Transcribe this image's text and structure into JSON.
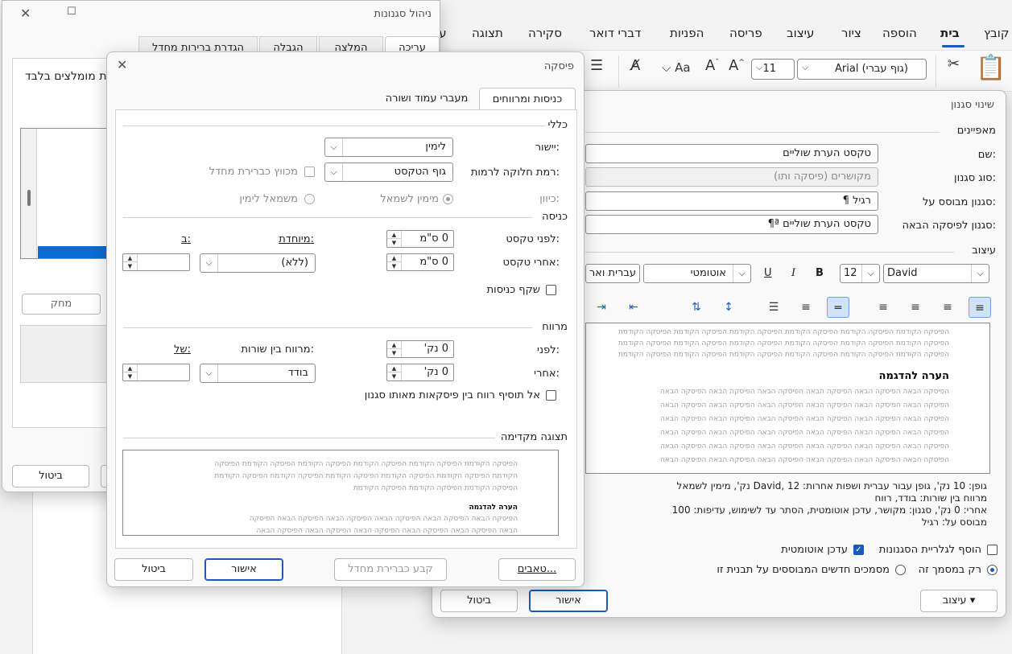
{
  "ribbon": {
    "tabs": [
      "קובץ",
      "בית",
      "הוספה",
      "ציור",
      "עיצוב",
      "פריסה",
      "הפניות",
      "דברי דואר",
      "סקירה",
      "תצוגה",
      "עז"
    ],
    "active_tab": "בית",
    "font_name": "Arial (גוף עברי)",
    "font_size": "11"
  },
  "manage_styles": {
    "title": "ניהול סגנונות",
    "tabs": [
      "עריכה",
      "המלצה",
      "הגבלה",
      "הגדרת ברירות מחדל"
    ],
    "recommended_only": "ת מומלצים בלבד",
    "delete_button": "מחק",
    "cancel_button": "ביטול"
  },
  "modify_style": {
    "title": "שינוי סגנון",
    "properties_header": "מאפיינים",
    "name_label": "שם:",
    "name_value": "טקסט הערת שוליים",
    "style_type_label": "סוג סגנון:",
    "style_type_value": "מקושרים (פיסקה ותו)",
    "based_on_label": "סגנון מבוסס על:",
    "based_on_value": "רגיל",
    "next_style_label": "סגנון לפיסקה הבאה:",
    "next_style_value": "טקסט הערת שוליים",
    "formatting_header": "עיצוב",
    "font_value": "David",
    "size_value": "12",
    "color_value": "אוטומטי",
    "script_value": "עברית ואר",
    "bold": "B",
    "italic": "I",
    "underline": "U",
    "preview_prev": "הפיסקה הקודמת הפיסקה הקודמת הפיסקה הקודמת הפיסקה הקודמת הפיסקה הקודמת הפיסקה הקודמת",
    "preview_sample": "הערה להדגמה",
    "preview_next": "הפיסקה הבאה הפיסקה הבאה הפיסקה הבאה הפיסקה הבאה הפיסקה הבאה הפיסקה הבאה",
    "description_lines": [
      "גופן: 10 נק', גופן עבור עברית ושפות אחרות: David, 12 נק', מימין לשמאל",
      "מרווח בין שורות:  בודד, רווח",
      "אחרי:  0  נק', סגנון: מקושר, עדכן אוטומטית, הסתר עד לשימוש, עדיפות: 100",
      "מבוסס על: רגיל"
    ],
    "add_to_gallery": "הוסף לגלריית הסגנונות",
    "auto_update": "עדכן אוטומטית",
    "only_this_doc": "רק במסמך זה",
    "new_docs": "מסמכים חדשים המבוססים על תבנית זו",
    "format_button": "עיצוב",
    "ok_button": "אישור",
    "cancel_button": "ביטול"
  },
  "paragraph": {
    "title": "פיסקה",
    "tabs": [
      "כניסות ומרווחים",
      "מעברי עמוד ושורה"
    ],
    "general_header": "כללי",
    "alignment_label": "יישור:",
    "alignment_value": "לימין",
    "outline_label": "רמת חלוקה לרמות:",
    "outline_value": "גוף הטקסט",
    "collapsed_label": "מכווץ כברירת מחדל",
    "direction_label": "כיוון:",
    "rtl_label": "מימין לשמאל",
    "ltr_label": "משמאל לימין",
    "indent_header": "כניסה",
    "before_text_label": "לפני טקסט:",
    "before_text_value": "0 ס\"מ",
    "after_text_label": "אחרי טקסט:",
    "after_text_value": "0 ס\"מ",
    "special_label": "מיוחדת:",
    "special_value": "(ללא)",
    "by_label": "ב:",
    "mirror_label": "שקף כניסות",
    "spacing_header": "מרווח",
    "before_label": "לפני:",
    "before_value": "0 נק'",
    "after_label": "אחרי:",
    "after_value": "0 נק'",
    "line_spacing_label": "מרווח בין שורות:",
    "line_spacing_value": "בודד",
    "at_label": "של:",
    "no_space_label": "אל תוסיף רווח בין פיסקאות מאותו סגנון",
    "preview_header": "תצוגה מקדימה",
    "preview_prev_1": "הפיסקה הקודמת הפיסקה הקודמת הפיסקה הקודמת הפיסקה הקודמת הפיסקה הקודמת הפיסקה",
    "preview_prev_2": "הקודמת הפיסקה הקודמת הפיסקה הקודמת הפיסקה הקודמת הפיסקה הקודמת הפיסקה הקודמת",
    "preview_prev_3": "הפיסקה הקודמת הפיסקה הקודמת הפיסקה הקודמת",
    "preview_sample": "הערה להדגמה",
    "preview_next_1": "הפיסקה הבאה הפיסקה הבאה הפיסקה הבאה הפיסקה הבאה הפיסקה הבאה הפיסקה",
    "preview_next_2": "הבאה הפיסקה הבאה הפיסקה הבאה הפיסקה הבאה הפיסקה הבאה הפיסקה הבאה",
    "tabs_button": "טאבים...",
    "default_button": "קבע כברירת מחדל",
    "ok_button": "אישור",
    "cancel_button": "ביטול"
  }
}
